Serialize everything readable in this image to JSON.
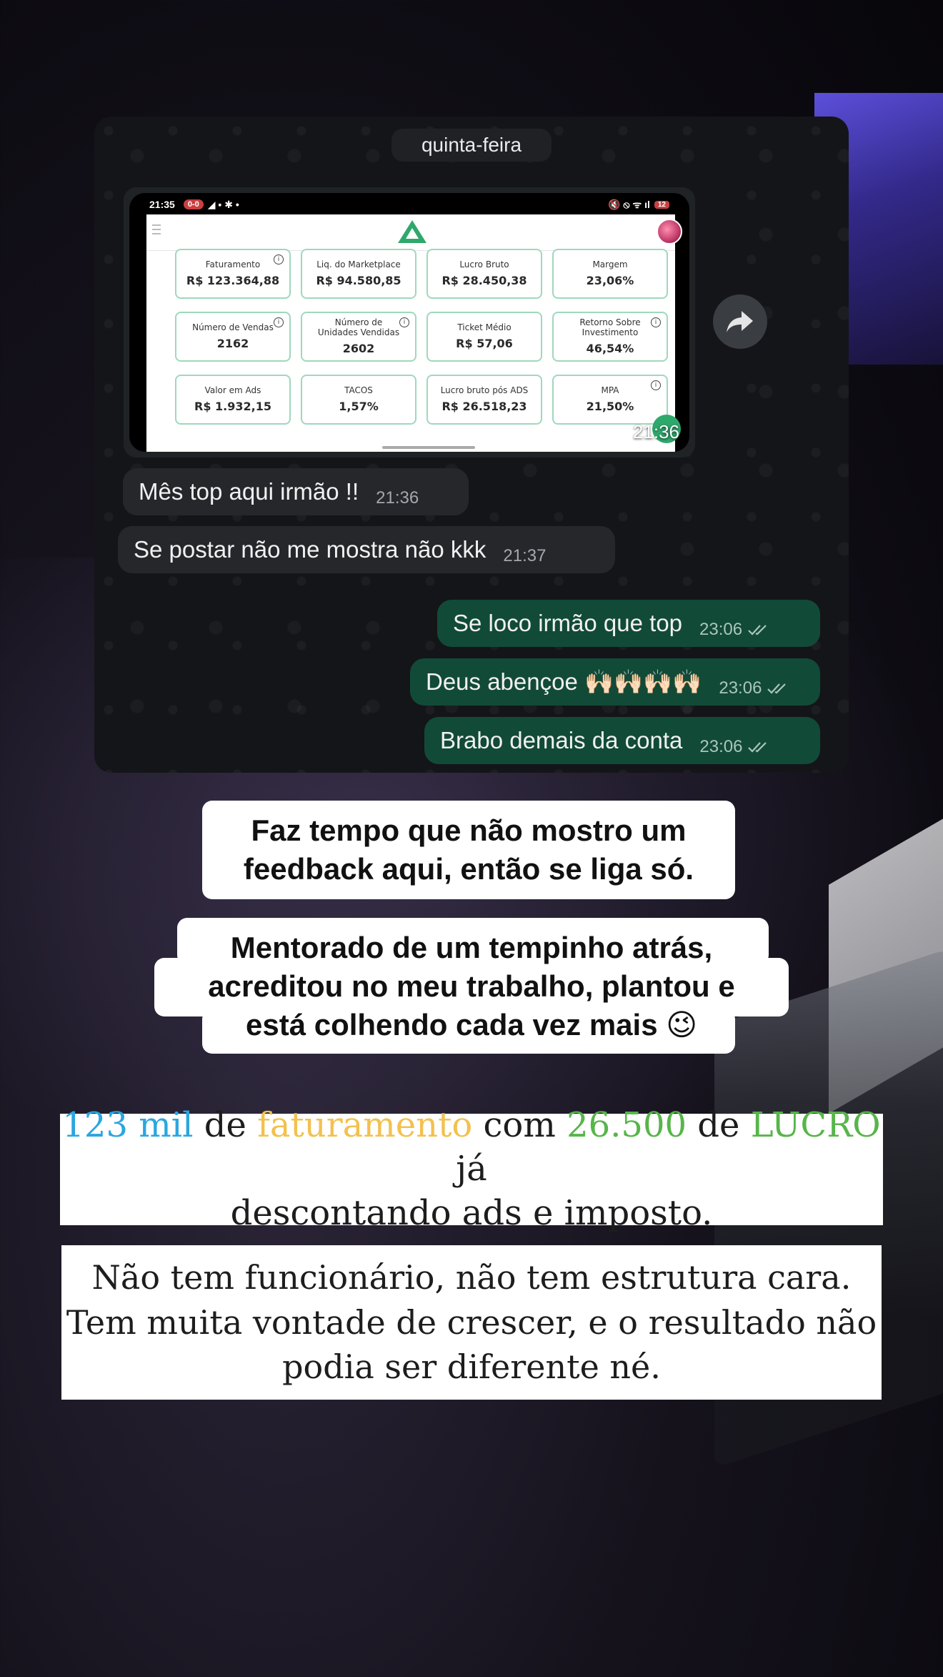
{
  "chat": {
    "date_label": "quinta-feira",
    "screenshot": {
      "status_time": "21:35",
      "status_pill": "0-0",
      "battery": "12",
      "metrics": [
        {
          "label": "Faturamento",
          "value": "R$ 123.364,88",
          "info": true
        },
        {
          "label": "Liq. do Marketplace",
          "value": "R$ 94.580,85",
          "info": false
        },
        {
          "label": "Lucro Bruto",
          "value": "R$ 28.450,38",
          "info": false
        },
        {
          "label": "Margem",
          "value": "23,06%",
          "info": false
        },
        {
          "label": "Número de Vendas",
          "value": "2162",
          "info": true
        },
        {
          "label": "Número de Unidades Vendidas",
          "value": "2602",
          "info": true
        },
        {
          "label": "Ticket Médio",
          "value": "R$ 57,06",
          "info": false
        },
        {
          "label": "Retorno Sobre Investimento",
          "value": "46,54%",
          "info": true
        },
        {
          "label": "Valor em Ads",
          "value": "R$ 1.932,15",
          "info": false
        },
        {
          "label": "TACOS",
          "value": "1,57%",
          "info": false
        },
        {
          "label": "Lucro bruto pós ADS",
          "value": "R$ 26.518,23",
          "info": false
        },
        {
          "label": "MPA",
          "value": "21,50%",
          "info": true
        }
      ],
      "time": "21:36"
    },
    "messages": [
      {
        "text": "Mês top aqui irmão !!",
        "time": "21:36",
        "dir": "in"
      },
      {
        "text": "Se postar não me mostra não kkk",
        "time": "21:37",
        "dir": "in"
      },
      {
        "text": "Se loco irmão que top",
        "time": "23:06",
        "dir": "out"
      },
      {
        "text": "Deus abençoe 🙌🏻🙌🏻🙌🏻🙌🏻",
        "time": "23:06",
        "dir": "out"
      },
      {
        "text": "Brabo demais da conta",
        "time": "23:06",
        "dir": "out"
      }
    ]
  },
  "captions": {
    "first": [
      "Faz tempo que não mostro um",
      "feedback aqui, então se liga só."
    ],
    "second": [
      "Mentorado de um tempinho atrás,",
      "acreditou no meu trabalho, plantou e",
      "está colhendo cada vez mais 😉"
    ],
    "third": {
      "part1": "123 mil",
      "part2": " de ",
      "part3": "faturamento",
      "part4": " com ",
      "part5": "26.500",
      "part6": " de ",
      "part7": "LUCRO",
      "part8": " já",
      "line2": "descontando ads e imposto."
    },
    "fourth": [
      "Não tem funcionário, não tem estrutura cara.",
      "Tem muita vontade de crescer, e o resultado não",
      "podia ser diferente né."
    ]
  },
  "colors": {
    "outgoing_bubble": "#124a38",
    "incoming_bubble": "#25272b",
    "accent_blue": "#2aa6df",
    "accent_yellow": "#f2c14e",
    "accent_green": "#57b54a"
  }
}
